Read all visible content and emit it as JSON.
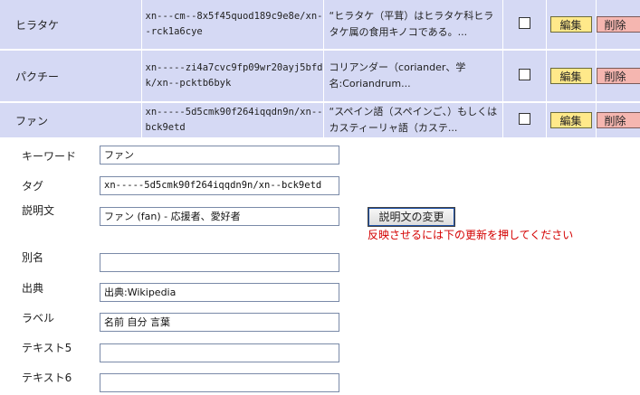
{
  "rows": [
    {
      "name": "ヒラタケ",
      "tag": "xn---cm--8x5f45quod189c9e8e/xn--rck1a6cye",
      "description": "“ヒラタケ（平茸）はヒラタケ科ヒラタケ属の食用キノコである。...",
      "edit": "編集",
      "delete": "削除"
    },
    {
      "name": "パクチー",
      "tag": "xn-----zi4a7cvc9fp09wr20ayj5bfdk/xn--pcktb6byk",
      "description": "コリアンダー（coriander、学名:Coriandrum...",
      "edit": "編集",
      "delete": "削除"
    },
    {
      "name": "ファン",
      "tag": "xn-----5d5cmk90f264iqqdn9n/xn--bck9etd",
      "description": "“スペイン語（スペインご、）もしくはカスティーリャ語（カステ...",
      "edit": "編集",
      "delete": "削除"
    }
  ],
  "form": {
    "keyword_label": "キーワード",
    "keyword_value": "ファン",
    "tag_label": "タグ",
    "tag_value": "xn-----5d5cmk90f264iqqdn9n/xn--bck9etd",
    "desc_label": "説明文",
    "desc_value": "ファン (fan) - 応援者、愛好者",
    "change_button": "説明文の変更",
    "note": "反映させるには下の更新を押してください",
    "alias_label": "別名",
    "alias_value": "",
    "source_label": "出典",
    "source_value": "出典:Wikipedia",
    "label_label": "ラベル",
    "label_value": "名前 自分 言葉",
    "text5_label": "テキスト5",
    "text5_value": "",
    "text6_label": "テキスト6",
    "text6_value": ""
  }
}
